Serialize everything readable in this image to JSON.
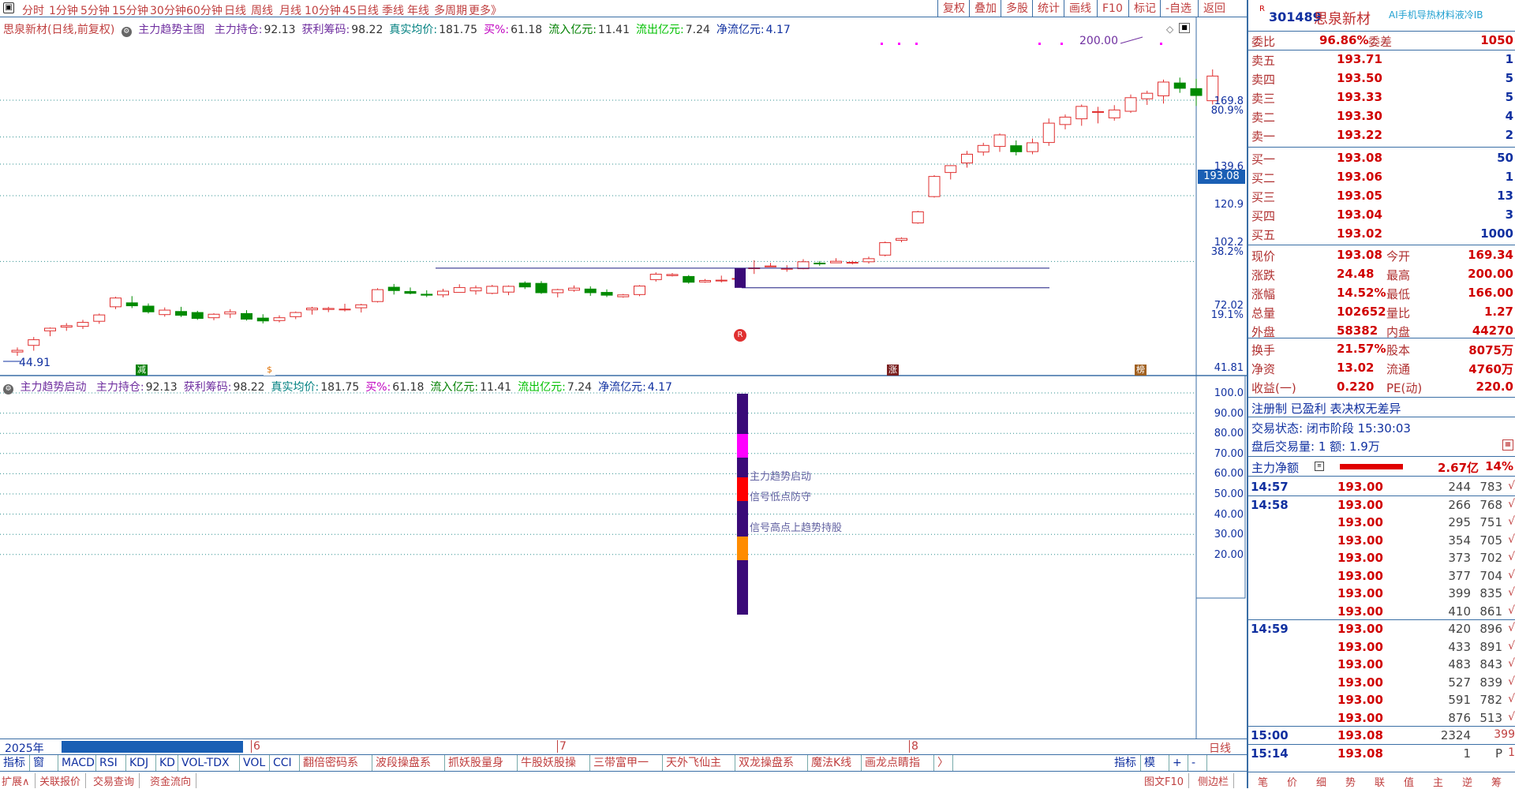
{
  "topbar": {
    "periods": [
      "分时",
      "1分钟",
      "5分钟",
      "15分钟",
      "30分钟",
      "60分钟",
      "日线",
      "周线",
      "月线",
      "10分钟",
      "45日线",
      "季线",
      "年线",
      "多周期",
      "更多》"
    ],
    "right": [
      "复权",
      "叠加",
      "多股",
      "统计",
      "画线",
      "F10",
      "标记",
      "-自选",
      "返回"
    ]
  },
  "main_legend": {
    "name": "思泉新材(日线,前复权)",
    "indicator": "主力趋势主图",
    "items": [
      {
        "label": "主力持仓:",
        "value": "92.13"
      },
      {
        "label": "获利筹码:",
        "value": "98.22"
      },
      {
        "label": "真实均价:",
        "value": "181.75"
      },
      {
        "label": "买%:",
        "value": "61.18"
      },
      {
        "label": "流入亿元:",
        "value": "11.41"
      },
      {
        "label": "流出亿元:",
        "value": "7.24"
      },
      {
        "label": "净流亿元:",
        "value": "4.17"
      }
    ]
  },
  "sub_legend": {
    "indicator": "主力趋势启动",
    "items": [
      {
        "label": "主力持仓:",
        "value": "92.13"
      },
      {
        "label": "获利筹码:",
        "value": "98.22"
      },
      {
        "label": "真实均价:",
        "value": "181.75"
      },
      {
        "label": "买%:",
        "value": "61.18"
      },
      {
        "label": "流入亿元:",
        "value": "11.41"
      },
      {
        "label": "流出亿元:",
        "value": "7.24"
      },
      {
        "label": "净流亿元:",
        "value": "4.17"
      }
    ]
  },
  "price_axis": {
    "labels": [
      "169.8",
      "80.9%",
      "139.6",
      "120.9",
      "102.2",
      "38.2%",
      "72.02",
      "19.1%",
      "41.81"
    ],
    "current": "193.08"
  },
  "sub_axis": {
    "labels": [
      "100.0",
      "90.00",
      "80.00",
      "70.00",
      "60.00",
      "50.00",
      "40.00",
      "30.00",
      "20.00"
    ]
  },
  "chart_annotations": {
    "high": "200.00",
    "low": "44.91",
    "marker_r": "R",
    "marks": [
      "减",
      "$",
      "涨",
      "榜"
    ]
  },
  "sub_signals": [
    "主力趋势启动",
    "信号低点防守",
    "信号高点上趋势持股"
  ],
  "time_axis": {
    "year": "2025年",
    "months": [
      "6",
      "7",
      "8"
    ],
    "bar_label": "日线"
  },
  "bottom_tabs": [
    "指标A",
    "窗口",
    "MACD",
    "RSI",
    "KDJ",
    "KD",
    "VOL-TDX",
    "VOL",
    "CCI",
    "翻倍密码系统",
    "波段操盘系统",
    "抓妖股量身板",
    "牛股妖股操盘",
    "三带富甲一方",
    "天外飞仙主图",
    "双龙操盘系统",
    "魔法K线操盘",
    "画龙点睛指标",
    "〉",
    "指标B",
    "模板",
    "+",
    "-"
  ],
  "bottom_tabs2": [
    "扩展∧",
    "关联报价",
    "交易查询",
    "资金流向",
    "图文F10",
    "侧边栏"
  ],
  "stock": {
    "code_prefix": "R",
    "code": "301489",
    "name": "思泉新材",
    "ad": "AI手机导热材料液冷IB"
  },
  "weibi": {
    "label1": "委比",
    "value1": "96.86%",
    "label2": "委差",
    "value2": "1050"
  },
  "sells": [
    {
      "label": "卖五",
      "price": "193.71",
      "vol": "1"
    },
    {
      "label": "卖四",
      "price": "193.50",
      "vol": "5"
    },
    {
      "label": "卖三",
      "price": "193.33",
      "vol": "5"
    },
    {
      "label": "卖二",
      "price": "193.30",
      "vol": "4"
    },
    {
      "label": "卖一",
      "price": "193.22",
      "vol": "2"
    }
  ],
  "buys": [
    {
      "label": "买一",
      "price": "193.08",
      "vol": "50"
    },
    {
      "label": "买二",
      "price": "193.06",
      "vol": "1"
    },
    {
      "label": "买三",
      "price": "193.05",
      "vol": "13"
    },
    {
      "label": "买四",
      "price": "193.04",
      "vol": "3"
    },
    {
      "label": "买五",
      "price": "193.02",
      "vol": "1000"
    }
  ],
  "quote": [
    {
      "l1": "现价",
      "v1": "193.08",
      "l2": "今开",
      "v2": "169.34"
    },
    {
      "l1": "涨跌",
      "v1": "24.48",
      "l2": "最高",
      "v2": "200.00"
    },
    {
      "l1": "涨幅",
      "v1": "14.52%",
      "l2": "最低",
      "v2": "166.00"
    },
    {
      "l1": "总量",
      "v1": "102652",
      "l2": "量比",
      "v2": "1.27"
    },
    {
      "l1": "外盘",
      "v1": "58382",
      "l2": "内盘",
      "v2": "44270"
    }
  ],
  "quote2": [
    {
      "l1": "换手",
      "v1": "21.57%",
      "l2": "股本",
      "v2": "8075万"
    },
    {
      "l1": "净资",
      "v1": "13.02",
      "l2": "流通",
      "v2": "4760万"
    },
    {
      "l1": "收益(一)",
      "v1": "0.220",
      "l2": "PE(动)",
      "v2": "220.0"
    }
  ],
  "status": {
    "reg": "注册制 已盈利 表决权无差异",
    "state": "交易状态: 闭市阶段 15:30:03",
    "after": "盘后交易量: 1  额: 1.9万"
  },
  "capital": {
    "label": "主力净额",
    "value": "2.67亿",
    "pct": "14%"
  },
  "ticks": [
    {
      "t": "14:57",
      "p": "193.00",
      "v": "244",
      "c": "783",
      "d": "√"
    },
    {
      "t": "14:58",
      "p": "193.00",
      "v": "266",
      "c": "768",
      "d": "√"
    },
    {
      "t": "",
      "p": "193.00",
      "v": "295",
      "c": "751",
      "d": "√"
    },
    {
      "t": "",
      "p": "193.00",
      "v": "354",
      "c": "705",
      "d": "√"
    },
    {
      "t": "",
      "p": "193.00",
      "v": "373",
      "c": "702",
      "d": "√"
    },
    {
      "t": "",
      "p": "193.00",
      "v": "377",
      "c": "704",
      "d": "√"
    },
    {
      "t": "",
      "p": "193.00",
      "v": "399",
      "c": "835",
      "d": "√"
    },
    {
      "t": "",
      "p": "193.00",
      "v": "410",
      "c": "861",
      "d": "√"
    },
    {
      "t": "14:59",
      "p": "193.00",
      "v": "420",
      "c": "896",
      "d": "√"
    },
    {
      "t": "",
      "p": "193.00",
      "v": "433",
      "c": "891",
      "d": "√"
    },
    {
      "t": "",
      "p": "193.00",
      "v": "483",
      "c": "843",
      "d": "√"
    },
    {
      "t": "",
      "p": "193.00",
      "v": "527",
      "c": "839",
      "d": "√"
    },
    {
      "t": "",
      "p": "193.00",
      "v": "591",
      "c": "782",
      "d": "√"
    },
    {
      "t": "",
      "p": "193.00",
      "v": "876",
      "c": "513",
      "d": "√"
    },
    {
      "t": "15:00",
      "p": "193.08",
      "v": "2324",
      "c": "",
      "d": "399"
    },
    {
      "t": "15:14",
      "p": "193.08",
      "v": "1",
      "c": "P",
      "d": "1"
    }
  ],
  "rp_bottom": [
    "笔",
    "价",
    "细",
    "势",
    "联",
    "值",
    "主",
    "逆",
    "筹"
  ],
  "candles": [
    {
      "o": 44.5,
      "h": 45.6,
      "l": 43.6,
      "c": 44.9
    },
    {
      "o": 46.1,
      "h": 48.2,
      "l": 44.8,
      "c": 47.5
    },
    {
      "o": 49.8,
      "h": 50.7,
      "l": 48.4,
      "c": 50.5
    },
    {
      "o": 50.8,
      "h": 51.9,
      "l": 49.8,
      "c": 51.2
    },
    {
      "o": 51,
      "h": 52.8,
      "l": 50.3,
      "c": 52.1
    },
    {
      "o": 52.4,
      "h": 54.6,
      "l": 51.7,
      "c": 54.2
    },
    {
      "o": 56.6,
      "h": 59.7,
      "l": 55.9,
      "c": 59.3
    },
    {
      "o": 57.8,
      "h": 59.9,
      "l": 56.2,
      "c": 56.9
    },
    {
      "o": 56.8,
      "h": 57.6,
      "l": 54.6,
      "c": 55.1
    },
    {
      "o": 54.3,
      "h": 56.4,
      "l": 53.7,
      "c": 55.6
    },
    {
      "o": 55.2,
      "h": 56.6,
      "l": 53.6,
      "c": 54.1
    },
    {
      "o": 54.9,
      "h": 55.4,
      "l": 52.8,
      "c": 53.2
    },
    {
      "o": 53.4,
      "h": 54.7,
      "l": 52.7,
      "c": 54.4
    },
    {
      "o": 54.5,
      "h": 55.9,
      "l": 53.3,
      "c": 55.1
    },
    {
      "o": 54.6,
      "h": 55.6,
      "l": 52.6,
      "c": 53
    },
    {
      "o": 53.3,
      "h": 54.4,
      "l": 51.8,
      "c": 52.5
    },
    {
      "o": 52.6,
      "h": 54.1,
      "l": 52.1,
      "c": 53.4
    },
    {
      "o": 53.7,
      "h": 55.2,
      "l": 53,
      "c": 54.9
    },
    {
      "o": 55.7,
      "h": 56.6,
      "l": 54.3,
      "c": 56.2
    },
    {
      "o": 55.8,
      "h": 56.6,
      "l": 55,
      "c": 56.1
    },
    {
      "o": 55.7,
      "h": 57.5,
      "l": 55.2,
      "c": 55.9
    },
    {
      "o": 56.3,
      "h": 57.5,
      "l": 54.9,
      "c": 57.2
    },
    {
      "o": 58.2,
      "h": 62.5,
      "l": 57.9,
      "c": 62
    },
    {
      "o": 62.8,
      "h": 63.9,
      "l": 60.4,
      "c": 61.7
    },
    {
      "o": 61.4,
      "h": 62.7,
      "l": 60.5,
      "c": 60.8
    },
    {
      "o": 60.5,
      "h": 61.8,
      "l": 59.6,
      "c": 60.2
    },
    {
      "o": 60.3,
      "h": 62.3,
      "l": 59.5,
      "c": 61.5
    },
    {
      "o": 61.1,
      "h": 63.8,
      "l": 61,
      "c": 62.7
    },
    {
      "o": 61.6,
      "h": 63.4,
      "l": 60.4,
      "c": 62.6
    },
    {
      "o": 60.8,
      "h": 63.6,
      "l": 60.5,
      "c": 63.1
    },
    {
      "o": 61.2,
      "h": 63.4,
      "l": 60.2,
      "c": 63.1
    },
    {
      "o": 64.2,
      "h": 64.8,
      "l": 62.2,
      "c": 62.9
    },
    {
      "o": 64.1,
      "h": 64.9,
      "l": 60.6,
      "c": 61
    },
    {
      "o": 61,
      "h": 62.3,
      "l": 59.5,
      "c": 62
    },
    {
      "o": 61.8,
      "h": 63.4,
      "l": 61.3,
      "c": 62.5
    },
    {
      "o": 62.2,
      "h": 63.1,
      "l": 60,
      "c": 61
    },
    {
      "o": 61.1,
      "h": 62.1,
      "l": 59.6,
      "c": 60.2
    },
    {
      "o": 59.7,
      "h": 60.6,
      "l": 59.4,
      "c": 60.3
    },
    {
      "o": 60.4,
      "h": 63.5,
      "l": 59.9,
      "c": 63.2
    },
    {
      "o": 65.4,
      "h": 68,
      "l": 64.7,
      "c": 67.3
    },
    {
      "o": 66.8,
      "h": 67.7,
      "l": 66.5,
      "c": 67.2
    },
    {
      "o": 66.5,
      "h": 67,
      "l": 64,
      "c": 64.5
    },
    {
      "o": 64.6,
      "h": 65.6,
      "l": 64.3,
      "c": 65.1
    },
    {
      "o": 65.1,
      "h": 66.8,
      "l": 64.4,
      "c": 65.2
    },
    {
      "o": 65.6,
      "h": 68.4,
      "l": 64.9,
      "c": 65.8
    },
    {
      "o": 69.6,
      "h": 72.5,
      "l": 67.4,
      "c": 69.6
    },
    {
      "o": 70.1,
      "h": 71.5,
      "l": 69.9,
      "c": 70.3
    },
    {
      "o": 69.2,
      "h": 70.6,
      "l": 68.2,
      "c": 69.4
    },
    {
      "o": 69.3,
      "h": 72.9,
      "l": 69.1,
      "c": 71.9
    },
    {
      "o": 71.4,
      "h": 72.2,
      "l": 70.4,
      "c": 71.3
    },
    {
      "o": 71.5,
      "h": 73.3,
      "l": 71.4,
      "c": 72.1
    },
    {
      "o": 71.4,
      "h": 72.3,
      "l": 70.9,
      "c": 71.7
    },
    {
      "o": 71.9,
      "h": 73.9,
      "l": 71.2,
      "c": 73.1
    },
    {
      "o": 74.5,
      "h": 80.1,
      "l": 74,
      "c": 79.6
    },
    {
      "o": 80.6,
      "h": 81.9,
      "l": 79.8,
      "c": 81.4
    },
    {
      "o": 88.4,
      "h": 94.3,
      "l": 88,
      "c": 93.8
    },
    {
      "o": 101.7,
      "h": 114,
      "l": 101.2,
      "c": 113.2
    },
    {
      "o": 115.6,
      "h": 120.2,
      "l": 111.4,
      "c": 119.9
    },
    {
      "o": 121.6,
      "h": 129.7,
      "l": 118.6,
      "c": 127.4
    },
    {
      "o": 128.9,
      "h": 135.4,
      "l": 126.4,
      "c": 133.5
    },
    {
      "o": 132.8,
      "h": 142.3,
      "l": 129,
      "c": 141.2
    },
    {
      "o": 133.3,
      "h": 137.1,
      "l": 126.6,
      "c": 129.1
    },
    {
      "o": 129.2,
      "h": 138.5,
      "l": 127.4,
      "c": 135.4
    },
    {
      "o": 135.6,
      "h": 154.1,
      "l": 133.2,
      "c": 150.3
    },
    {
      "o": 149.2,
      "h": 157.4,
      "l": 145.4,
      "c": 155.2
    },
    {
      "o": 153.8,
      "h": 166,
      "l": 148.2,
      "c": 164.3
    },
    {
      "o": 159.6,
      "h": 163.9,
      "l": 150.1,
      "c": 159.8
    },
    {
      "o": 154.6,
      "h": 165.4,
      "l": 152.3,
      "c": 161.2
    },
    {
      "o": 160.1,
      "h": 175,
      "l": 158.7,
      "c": 172.1
    },
    {
      "o": 171.1,
      "h": 178.6,
      "l": 165.6,
      "c": 176.2
    },
    {
      "o": 173.8,
      "h": 189.5,
      "l": 166.8,
      "c": 187
    },
    {
      "o": 186.1,
      "h": 191.5,
      "l": 176.6,
      "c": 180.9
    },
    {
      "o": 180.6,
      "h": 190.3,
      "l": 164.7,
      "c": 174.1
    },
    {
      "o": 169.34,
      "h": 200,
      "l": 166,
      "c": 193.08
    }
  ],
  "colors": {
    "up": "#e03030",
    "down": "#008a00",
    "signal_purple": "#3a0a78",
    "signal_magenta": "#ff00ff",
    "signal_red": "#ff0000",
    "signal_orange": "#ff8c00",
    "grid": "#2f8f8f",
    "axis_line": "#3a6ea5"
  }
}
